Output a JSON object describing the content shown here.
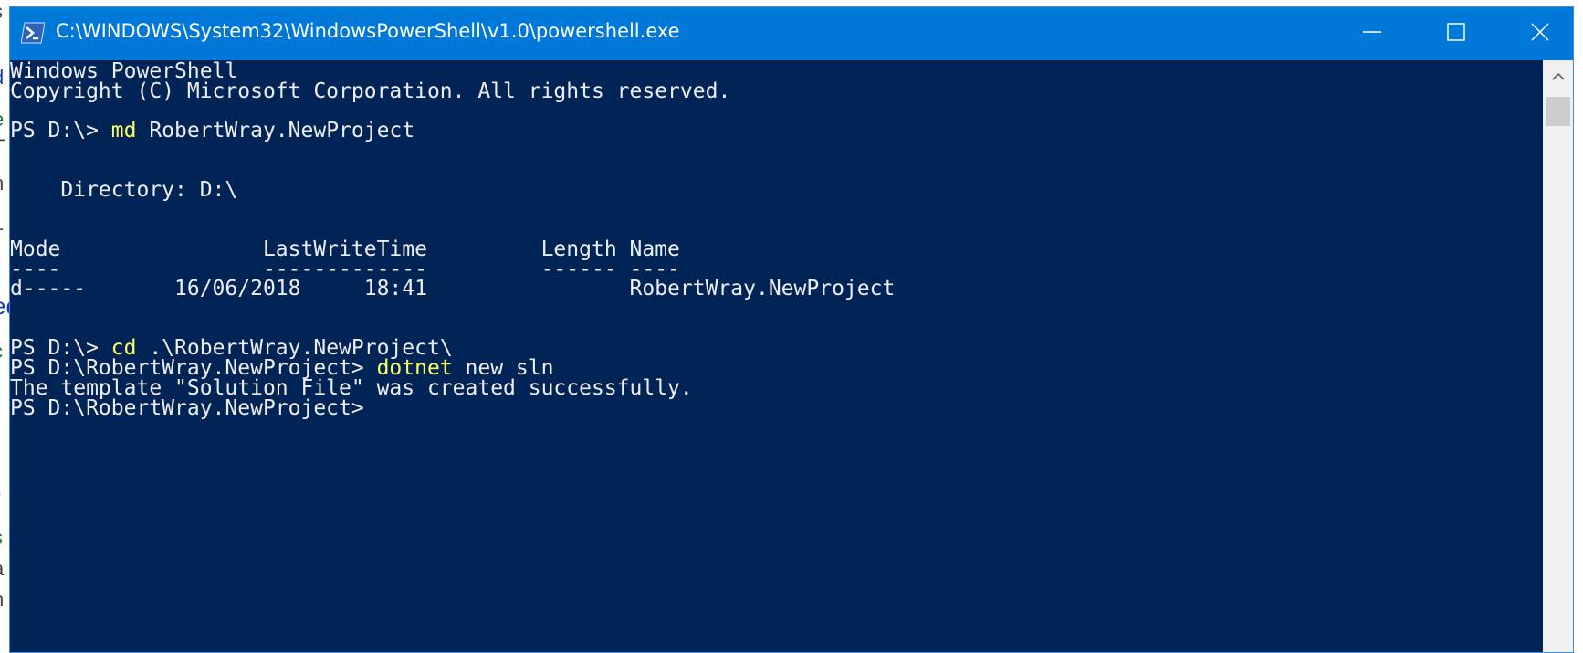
{
  "window": {
    "title": "C:\\WINDOWS\\System32\\WindowsPowerShell\\v1.0\\powershell.exe",
    "icon": "powershell-icon",
    "controls": {
      "minimize": "minimize-icon",
      "maximize": "maximize-icon",
      "close": "close-icon"
    }
  },
  "colors": {
    "titlebar": "#0078d7",
    "console_bg": "#012456",
    "console_text": "#eeedf0",
    "command_text": "#ffff66"
  },
  "console": {
    "banner_1": "Windows PowerShell",
    "banner_2": "Copyright (C) Microsoft Corporation. All rights reserved.",
    "prompt_1": "PS D:\\> ",
    "cmd_1": "md",
    "args_1": " RobertWray.NewProject",
    "directory_line": "    Directory: D:\\",
    "header_line": "Mode                LastWriteTime         Length Name",
    "underline_line": "----                -------------         ------ ----",
    "row_line": "d-----       16/06/2018     18:41                RobertWray.NewProject",
    "prompt_2": "PS D:\\> ",
    "cmd_2": "cd",
    "args_2": " .\\RobertWray.NewProject\\",
    "prompt_3": "PS D:\\RobertWray.NewProject> ",
    "cmd_3": "dotnet",
    "args_3": " new sln",
    "output_line": "The template \"Solution File\" was created successfully.",
    "prompt_4": "PS D:\\RobertWray.NewProject>"
  },
  "background_fragments": [
    "s",
    "d",
    "e",
    "T",
    "n",
    "1",
    "ed",
    "c",
    "i",
    "r",
    "r",
    "s",
    "a",
    "n"
  ]
}
